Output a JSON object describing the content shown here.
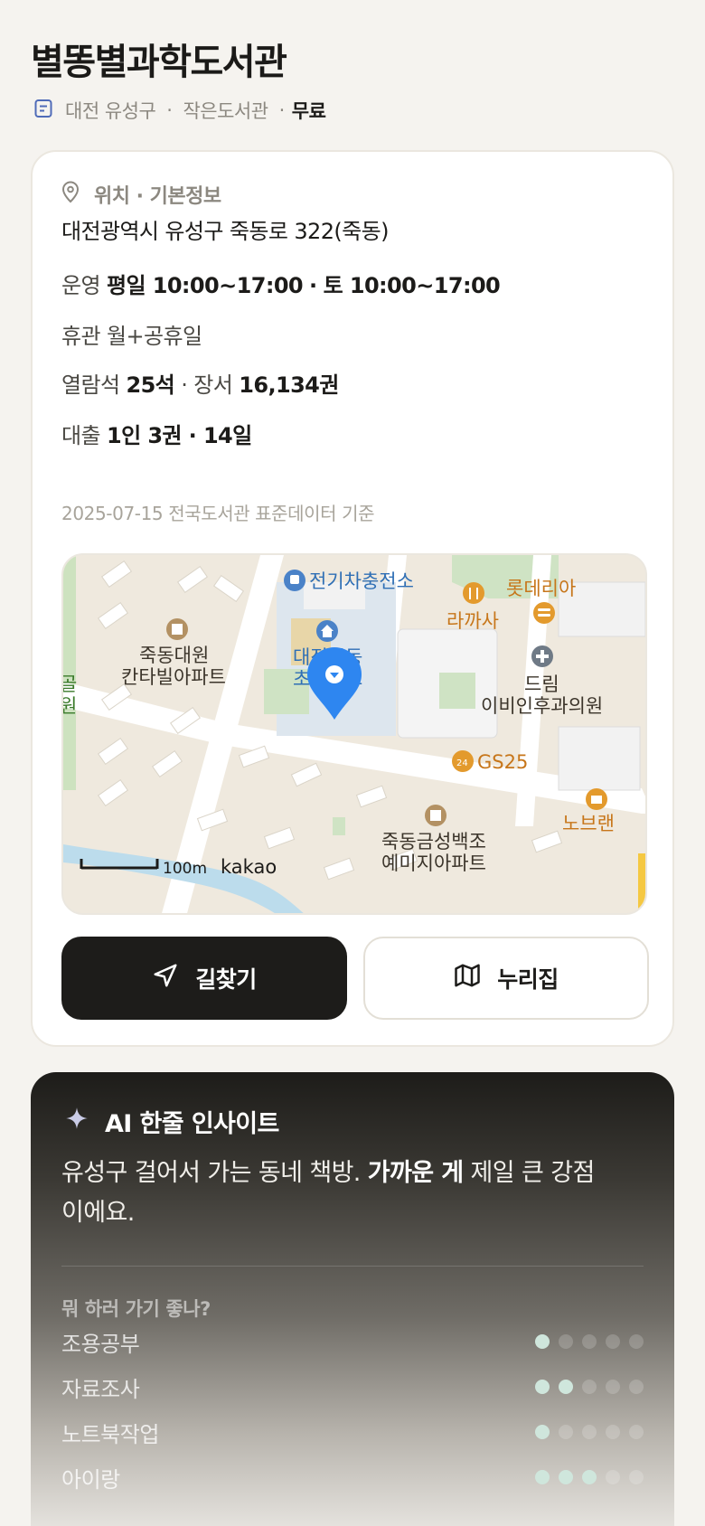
{
  "header": {
    "title": "별똥별과학도서관",
    "region": "대전 유성구",
    "type": "작은도서관",
    "fee": "무료",
    "dot": "·"
  },
  "info": {
    "section_title": "위치 · 기본정보",
    "address": "대전광역시 유성구 죽동로 322(죽동)",
    "hours_label": "운영",
    "hours_weekday": "평일 10:00~17:00",
    "hours_sat": "토 10:00~17:00",
    "closed_label": "휴관",
    "closed_value": "월+공휴일",
    "seats_label": "열람석",
    "seats_value": "25석",
    "books_label": "장서",
    "books_value": "16,134권",
    "loan_label": "대출",
    "loan_value": "1인 3권 · 14일",
    "source": "2025-07-15 전국도서관 표준데이터 기준",
    "sep": "·"
  },
  "map": {
    "labels": {
      "ev": "전기차충전소",
      "lotteria": "롯데리아",
      "rakasa": "라까사",
      "apt1_a": "죽동대원",
      "apt1_b": "칸타빌아파트",
      "school_a": "대전죽동",
      "school_b": "초등학교",
      "clinic_a": "드림",
      "clinic_b": "이비인후과의원",
      "gs25": "GS25",
      "apt2_a": "죽동금성백조",
      "apt2_b": "예미지아파트",
      "nobr": "노브랜",
      "edge_a": "골",
      "edge_b": "원",
      "scale": "100m",
      "brand": "kakao"
    }
  },
  "actions": {
    "route_label": "길찾기",
    "nuri_label": "누리집"
  },
  "insight": {
    "title": "AI 한줄 인사이트",
    "text_pre": "유성구 걸어서 가는 동네 책방. ",
    "text_bold": "가까운 게",
    "text_post": " 제일 큰 강점이에요.",
    "question": "뭐 하러 가기 좋나?",
    "activities": [
      {
        "name": "조용공부",
        "level": 1,
        "max": 5
      },
      {
        "name": "자료조사",
        "level": 2,
        "max": 5
      },
      {
        "name": "노트북작업",
        "level": 1,
        "max": 5
      },
      {
        "name": "아이랑",
        "level": 3,
        "max": 5
      }
    ]
  },
  "colors": {
    "accent_blue": "#3b82f6",
    "dot_on": "#cfe6dc",
    "poi_orange": "#e39a2d",
    "school_blue": "#4a82c8"
  }
}
